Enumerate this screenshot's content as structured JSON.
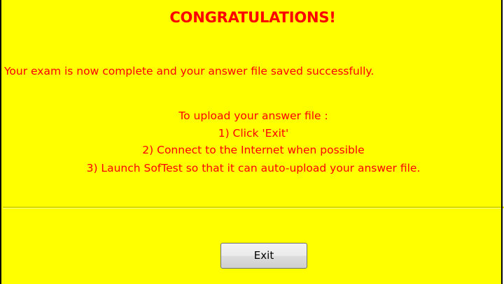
{
  "dialog": {
    "title": "CONGRATULATIONS!",
    "message": "Your exam is now complete and your answer file saved successfully.",
    "instructions": {
      "heading": "To upload your answer file :",
      "step1": "1) Click 'Exit'",
      "step2": "2) Connect to the Internet when possible",
      "step3": "3) Launch SofTest so that it can auto-upload your answer file."
    },
    "exit_label": "Exit"
  },
  "colors": {
    "background": "#ffff00",
    "text": "#ff0000"
  }
}
